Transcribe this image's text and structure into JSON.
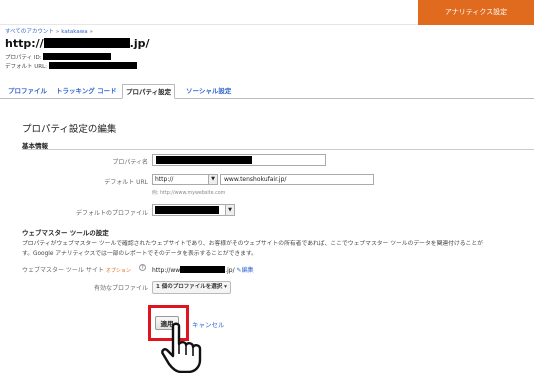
{
  "header": {
    "analytics_settings": "アナリティクス設定"
  },
  "breadcrumb": {
    "all_accounts": "すべてのアカウント",
    "separator": "»",
    "account": "katakawa"
  },
  "property": {
    "title_prefix": "http://",
    "title_suffix": ".jp/",
    "id_label": "プロパティ ID:",
    "default_url_label": "デフォルト URL:"
  },
  "tabs": [
    {
      "label": "プロファイル",
      "active": false
    },
    {
      "label": "トラッキング コード",
      "active": false
    },
    {
      "label": "プロパティ設定",
      "active": true
    },
    {
      "label": "ソーシャル設定",
      "active": false
    }
  ],
  "form": {
    "heading": "プロパティ設定の編集",
    "basic_info": "基本情報",
    "name_label": "プロパティ名",
    "url_label": "デフォルト URL",
    "protocol": "http://",
    "url_value": "www.tenshokufair.jp/",
    "url_hint": "例: http://www.mywebsite.com",
    "default_profile_label": "デフォルトのプロファイル"
  },
  "webmaster": {
    "heading": "ウェブマスター ツールの設定",
    "desc_line1": "プロパティがウェブマスター ツールで確認されたウェブサイトであり、お客様がそのウェブサイトの所有者であれば、ここでウェブマスター ツールのデータを関連付けることが",
    "desc_line2": "す。Google アナリティクスでは一部のレポートでそのデータを表示することができます。",
    "site_label": "ウェブマスター ツール サイト",
    "optional": "オプション",
    "help": "?",
    "site_prefix": "http://ww",
    "site_suffix": ".jp/",
    "edit_link": "編集",
    "profile_label": "有効なプロファイル",
    "profile_select": "1 個のプロファイルを選択"
  },
  "actions": {
    "apply": "適用",
    "cancel": "キャンセル"
  },
  "colors": {
    "accent": "#e06a1e",
    "link": "#3366cc",
    "highlight": "#e0141e"
  }
}
